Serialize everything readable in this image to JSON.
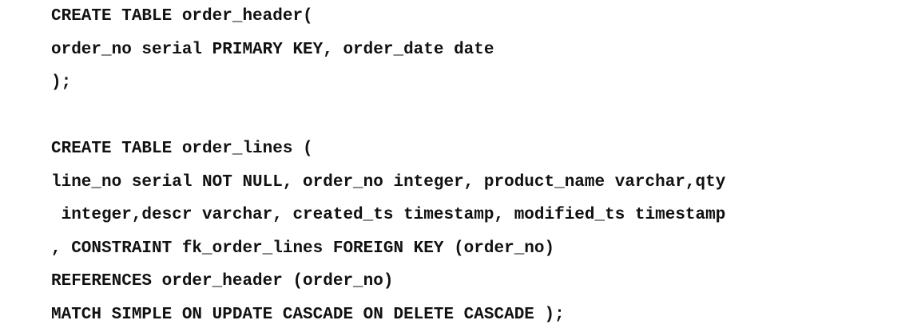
{
  "code": {
    "lines": [
      "CREATE TABLE order_header(",
      "order_no serial PRIMARY KEY, order_date date",
      ");",
      "",
      "CREATE TABLE order_lines (",
      "line_no serial NOT NULL, order_no integer, product_name varchar,qty",
      " integer,descr varchar, created_ts timestamp, modified_ts timestamp",
      ", CONSTRAINT fk_order_lines FOREIGN KEY (order_no)",
      "REFERENCES order_header (order_no)",
      "MATCH SIMPLE ON UPDATE CASCADE ON DELETE CASCADE );"
    ]
  }
}
